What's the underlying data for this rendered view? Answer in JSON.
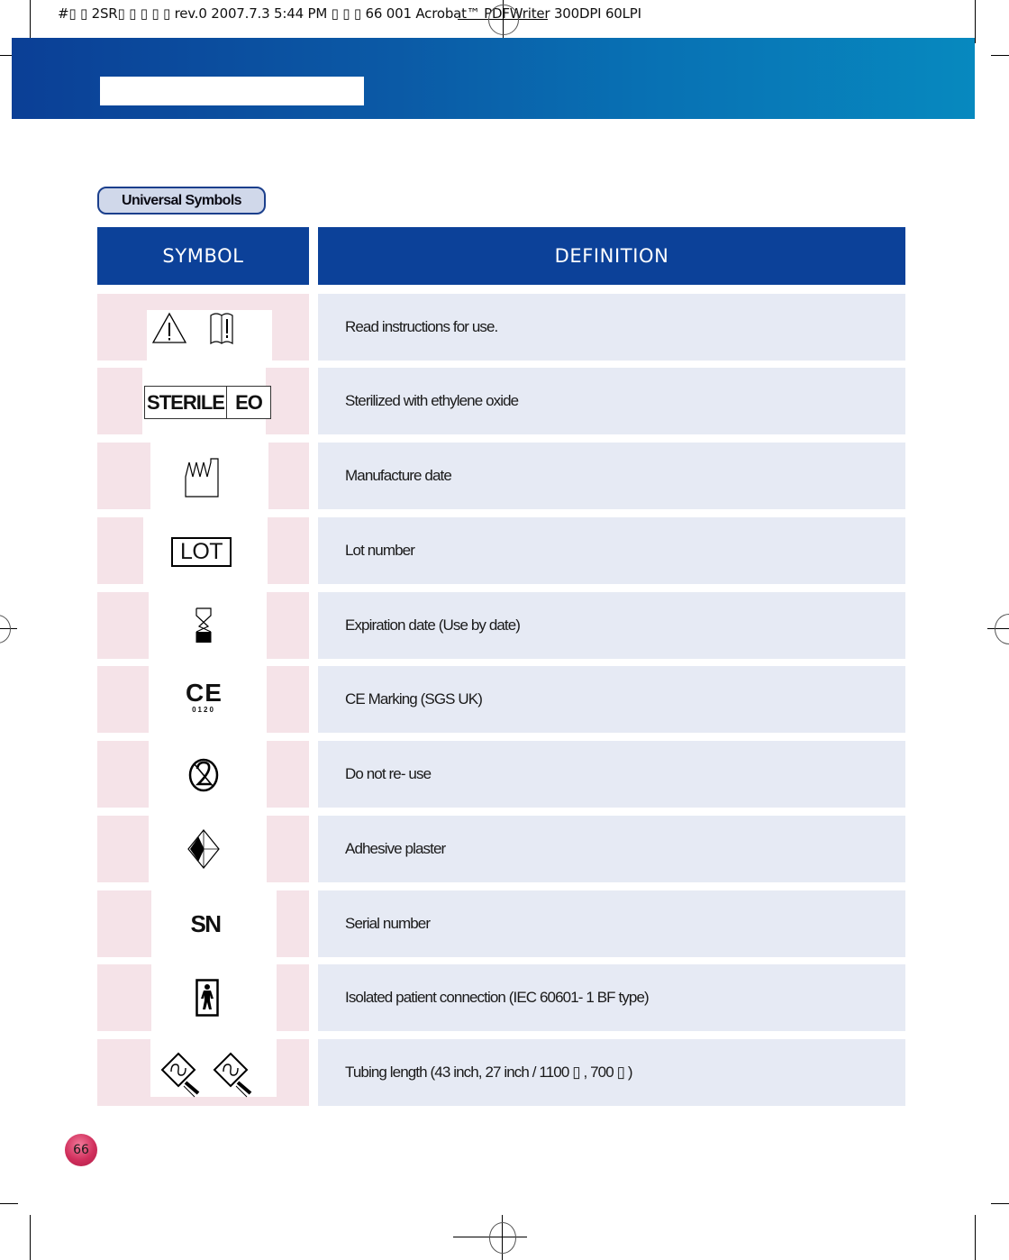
{
  "print_slug": "#▯ ▯ 2SR▯ ▯ ▯ ▯ ▯  rev.0  2007.7.3 5:44 PM  ▯ ▯ ▯ 66   001 Acrobat™ PDFWriter 300DPI 60LPI",
  "section_label": "Universal Symbols",
  "table": {
    "headers": {
      "symbol": "SYMBOL",
      "definition": "DEFINITION"
    },
    "rows": [
      {
        "symbol_icon": "caution-consult-instructions-icon",
        "definition": "Read instructions for use."
      },
      {
        "symbol_icon": "sterile-eo-icon",
        "symbol_text": [
          "STERILE",
          "EO"
        ],
        "definition": "Sterilized with ethylene oxide"
      },
      {
        "symbol_icon": "manufacture-date-icon",
        "definition": "Manufacture date"
      },
      {
        "symbol_icon": "lot-number-icon",
        "symbol_text": "LOT",
        "definition": "Lot number"
      },
      {
        "symbol_icon": "expiration-hourglass-icon",
        "definition": "Expiration date (Use by date)"
      },
      {
        "symbol_icon": "ce-mark-icon",
        "symbol_text": [
          "CE",
          "0120"
        ],
        "definition": "CE Marking (SGS UK)"
      },
      {
        "symbol_icon": "do-not-reuse-icon",
        "definition": "Do not re- use"
      },
      {
        "symbol_icon": "adhesive-plaster-icon",
        "definition": "Adhesive plaster"
      },
      {
        "symbol_icon": "serial-number-icon",
        "symbol_text": "SN",
        "definition": "Serial number"
      },
      {
        "symbol_icon": "bf-type-patient-icon",
        "definition": "Isolated patient connection (IEC 60601- 1 BF type)"
      },
      {
        "symbol_icon": "tubing-length-icon",
        "definition": "Tubing length (43 inch, 27 inch / 1100 ▯ , 700 ▯ )"
      }
    ]
  },
  "page_number": "66",
  "colors": {
    "header_blue": "#0c4199",
    "band_start": "#0b3f96",
    "band_end": "#0789bf",
    "symbol_cell": "#f5e3e8",
    "definition_cell": "#e6eaf4",
    "pill_fill": "#d0d8ea",
    "page_badge": "#d02f5c"
  }
}
